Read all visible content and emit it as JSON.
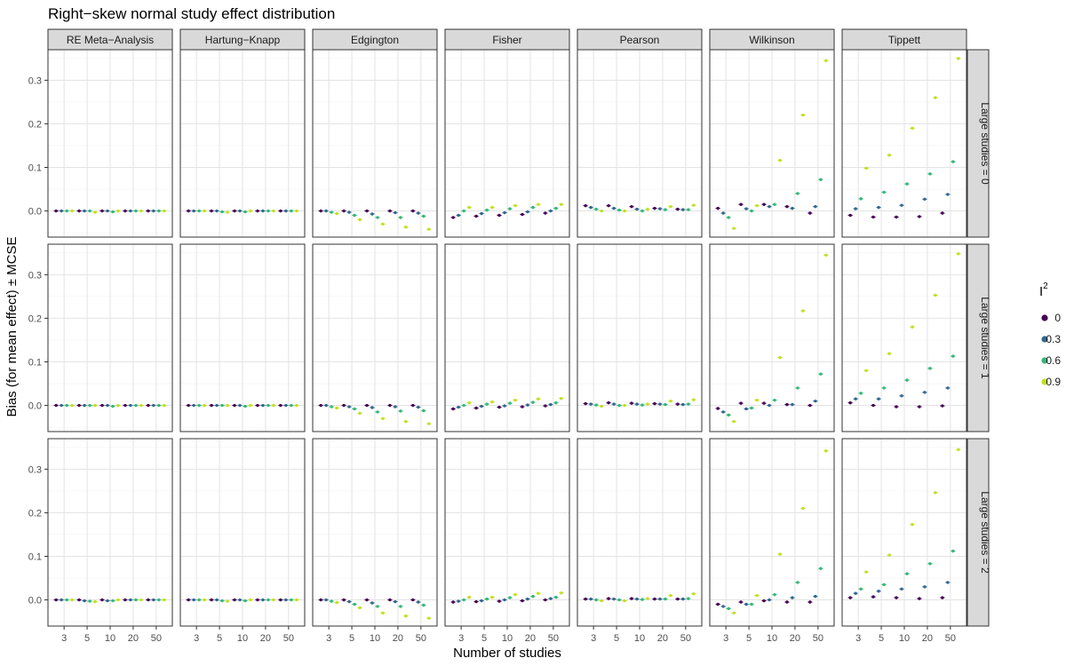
{
  "chart_data": {
    "type": "scatter",
    "title": "Right−skew normal study effect distribution",
    "xlabel": "Number of studies",
    "ylabel": "Bias (for mean effect) ± MCSE",
    "x_categories": [
      "3",
      "5",
      "10",
      "20",
      "50"
    ],
    "y_ticks": [
      0.0,
      0.1,
      0.2,
      0.3
    ],
    "y_tick_labels": [
      "0.0",
      "0.1",
      "0.2",
      "0.3"
    ],
    "ylim": [
      -0.06,
      0.37
    ],
    "grid": true,
    "legend_position": "right",
    "legend": {
      "title": "I",
      "title_superscript": "2",
      "entries": [
        {
          "label": "0",
          "color": "#440154"
        },
        {
          "label": "0.3",
          "color": "#31688E"
        },
        {
          "label": "0.6",
          "color": "#35B779"
        },
        {
          "label": "0.9",
          "color": "#C2DF23"
        }
      ]
    },
    "col_facets": [
      "RE Meta−Analysis",
      "Hartung−Knapp",
      "Edgington",
      "Fisher",
      "Pearson",
      "Wilkinson",
      "Tippett"
    ],
    "row_facets": [
      "Large studies = 0",
      "Large studies = 1",
      "Large studies = 2"
    ],
    "panels": [
      [
        [
          [
            0,
            0,
            0,
            0
          ],
          [
            0,
            0,
            0,
            -0.003
          ],
          [
            0,
            0,
            -0.002,
            0
          ],
          [
            0,
            0,
            0,
            0
          ],
          [
            0,
            0,
            0,
            0
          ]
        ],
        [
          [
            0,
            0,
            0,
            0
          ],
          [
            0,
            0,
            -0.002,
            -0.003
          ],
          [
            0,
            0,
            -0.002,
            0
          ],
          [
            0,
            0,
            0,
            0
          ],
          [
            0,
            0,
            0,
            0
          ]
        ],
        [
          [
            0,
            0,
            -0.003,
            -0.006
          ],
          [
            0,
            -0.003,
            -0.01,
            -0.02
          ],
          [
            0,
            -0.007,
            -0.015,
            -0.03
          ],
          [
            0,
            -0.004,
            -0.015,
            -0.037
          ],
          [
            0,
            -0.005,
            -0.012,
            -0.042
          ]
        ],
        [
          [
            -0.015,
            -0.01,
            0,
            0.008
          ],
          [
            -0.012,
            -0.006,
            0.002,
            0.008
          ],
          [
            -0.01,
            -0.004,
            0.005,
            0.012
          ],
          [
            -0.008,
            -0.002,
            0.008,
            0.015
          ],
          [
            -0.005,
            0,
            0.006,
            0.015
          ]
        ],
        [
          [
            0.012,
            0.008,
            0.004,
            0
          ],
          [
            0.012,
            0.006,
            0.002,
            0
          ],
          [
            0.01,
            0.004,
            0,
            0.004
          ],
          [
            0.006,
            0.005,
            0.003,
            0.01
          ],
          [
            0.004,
            0.003,
            0.003,
            0.013
          ]
        ],
        [
          [
            0.006,
            -0.005,
            -0.015,
            -0.04
          ],
          [
            0.015,
            0.005,
            0,
            0.012
          ],
          [
            0.015,
            0.01,
            0.015,
            0.116
          ],
          [
            0.01,
            0.006,
            0.04,
            0.22
          ],
          [
            -0.005,
            0.01,
            0.072,
            0.345
          ]
        ],
        [
          [
            -0.01,
            0.005,
            0.028,
            0.098
          ],
          [
            -0.014,
            0.008,
            0.043,
            0.128
          ],
          [
            -0.014,
            0.013,
            0.062,
            0.19
          ],
          [
            -0.013,
            0.027,
            0.085,
            0.26
          ],
          [
            -0.005,
            0.038,
            0.113,
            0.35
          ]
        ]
      ],
      [
        [
          [
            0,
            0,
            0,
            0
          ],
          [
            0,
            0,
            0,
            0
          ],
          [
            0,
            0,
            -0.002,
            0
          ],
          [
            0,
            0,
            0,
            0
          ],
          [
            0,
            0,
            0,
            0
          ]
        ],
        [
          [
            0,
            0,
            0,
            0
          ],
          [
            0,
            0,
            0,
            0
          ],
          [
            0,
            0,
            -0.002,
            0
          ],
          [
            0,
            0,
            0,
            0
          ],
          [
            0,
            0,
            0,
            0
          ]
        ],
        [
          [
            0,
            0,
            -0.003,
            -0.006
          ],
          [
            0,
            -0.003,
            -0.008,
            -0.018
          ],
          [
            0,
            -0.005,
            -0.015,
            -0.03
          ],
          [
            0,
            -0.003,
            -0.013,
            -0.037
          ],
          [
            0,
            -0.004,
            -0.012,
            -0.042
          ]
        ],
        [
          [
            -0.008,
            -0.004,
            0,
            0.006
          ],
          [
            -0.006,
            -0.002,
            0.003,
            0.008
          ],
          [
            -0.004,
            -0.001,
            0.005,
            0.012
          ],
          [
            -0.003,
            0.001,
            0.007,
            0.015
          ],
          [
            -0.001,
            0.002,
            0.006,
            0.016
          ]
        ],
        [
          [
            0.004,
            0.003,
            0.001,
            -0.002
          ],
          [
            0.006,
            0.003,
            0,
            0
          ],
          [
            0.005,
            0.003,
            0.001,
            0.003
          ],
          [
            0.004,
            0.003,
            0.002,
            0.01
          ],
          [
            0.003,
            0.002,
            0.003,
            0.013
          ]
        ],
        [
          [
            -0.007,
            -0.015,
            -0.022,
            -0.037
          ],
          [
            0.005,
            -0.008,
            -0.006,
            0.012
          ],
          [
            0.005,
            0,
            0.012,
            0.11
          ],
          [
            0.002,
            0.002,
            0.04,
            0.217
          ],
          [
            0,
            0.01,
            0.072,
            0.345
          ]
        ],
        [
          [
            0.006,
            0.015,
            0.028,
            0.08
          ],
          [
            0,
            0.015,
            0.04,
            0.119
          ],
          [
            -0.003,
            0.022,
            0.058,
            0.18
          ],
          [
            -0.003,
            0.03,
            0.085,
            0.253
          ],
          [
            -0.001,
            0.04,
            0.113,
            0.348
          ]
        ]
      ],
      [
        [
          [
            0,
            0,
            0,
            0
          ],
          [
            0,
            -0.002,
            -0.003,
            -0.004
          ],
          [
            0,
            -0.002,
            -0.002,
            0
          ],
          [
            0,
            0,
            0,
            0
          ],
          [
            0,
            0,
            0,
            0
          ]
        ],
        [
          [
            0,
            0,
            0,
            0
          ],
          [
            0,
            0,
            -0.002,
            -0.003
          ],
          [
            0,
            0,
            -0.002,
            0
          ],
          [
            0,
            0,
            0,
            0
          ],
          [
            0,
            0,
            0,
            0
          ]
        ],
        [
          [
            0,
            0,
            -0.003,
            -0.006
          ],
          [
            0,
            -0.004,
            -0.01,
            -0.018
          ],
          [
            0,
            -0.007,
            -0.015,
            -0.03
          ],
          [
            0,
            -0.004,
            -0.015,
            -0.037
          ],
          [
            0,
            -0.005,
            -0.012,
            -0.042
          ]
        ],
        [
          [
            -0.005,
            -0.003,
            0,
            0.006
          ],
          [
            -0.004,
            -0.002,
            0.002,
            0.006
          ],
          [
            -0.003,
            0,
            0.005,
            0.012
          ],
          [
            -0.002,
            0.002,
            0.008,
            0.015
          ],
          [
            0,
            0.003,
            0.006,
            0.016
          ]
        ],
        [
          [
            0.002,
            0.002,
            0,
            -0.002
          ],
          [
            0.003,
            0.002,
            0,
            -0.002
          ],
          [
            0.003,
            0.002,
            0.001,
            0.003
          ],
          [
            0.002,
            0.002,
            0.002,
            0.01
          ],
          [
            0.002,
            0.002,
            0.003,
            0.014
          ]
        ],
        [
          [
            -0.01,
            -0.015,
            -0.02,
            -0.03
          ],
          [
            -0.005,
            -0.01,
            -0.01,
            0.01
          ],
          [
            -0.002,
            0,
            0.012,
            0.105
          ],
          [
            -0.005,
            0.005,
            0.04,
            0.21
          ],
          [
            -0.005,
            0.008,
            0.072,
            0.342
          ]
        ],
        [
          [
            0.005,
            0.015,
            0.025,
            0.064
          ],
          [
            0.007,
            0.02,
            0.035,
            0.103
          ],
          [
            0.005,
            0.025,
            0.06,
            0.173
          ],
          [
            0.003,
            0.03,
            0.083,
            0.246
          ],
          [
            0.005,
            0.04,
            0.112,
            0.345
          ]
        ]
      ]
    ]
  }
}
